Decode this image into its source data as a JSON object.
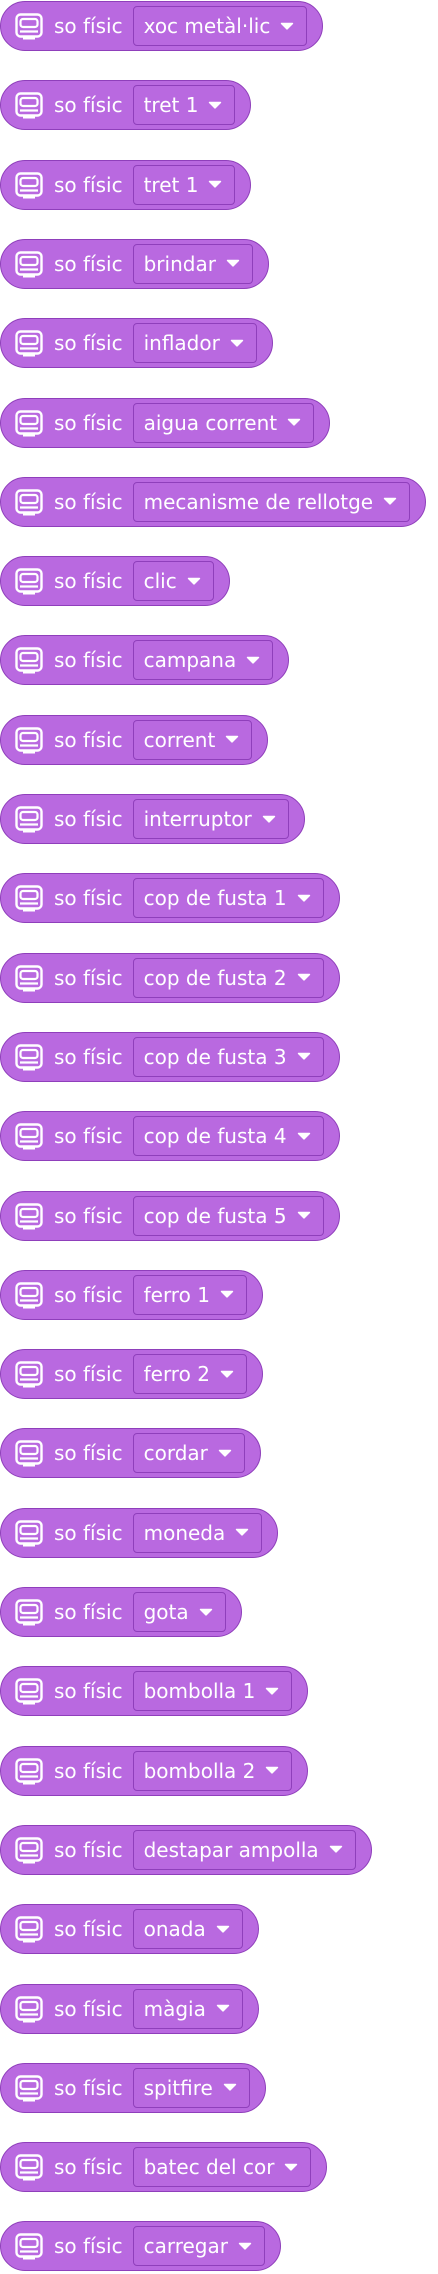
{
  "block_label": "so físic",
  "icon": "robot-speaker-icon",
  "colors": {
    "block_fill": "#b969e0",
    "block_border": "#8f3fbb",
    "text": "#ffffff"
  },
  "blocks": [
    {
      "value": "xoc metàl·lic"
    },
    {
      "value": "tret 1"
    },
    {
      "value": "tret 1"
    },
    {
      "value": "brindar"
    },
    {
      "value": "inflador"
    },
    {
      "value": "aigua corrent"
    },
    {
      "value": "mecanisme de rellotge"
    },
    {
      "value": "clic"
    },
    {
      "value": "campana"
    },
    {
      "value": "corrent"
    },
    {
      "value": "interruptor"
    },
    {
      "value": "cop de fusta 1"
    },
    {
      "value": "cop de fusta 2"
    },
    {
      "value": "cop de fusta 3"
    },
    {
      "value": "cop de fusta 4"
    },
    {
      "value": "cop de fusta 5"
    },
    {
      "value": "ferro 1"
    },
    {
      "value": "ferro 2"
    },
    {
      "value": "cordar"
    },
    {
      "value": "moneda"
    },
    {
      "value": "gota"
    },
    {
      "value": "bombolla 1"
    },
    {
      "value": "bombolla 2"
    },
    {
      "value": "destapar ampolla"
    },
    {
      "value": "onada"
    },
    {
      "value": "màgia"
    },
    {
      "value": "spitfire"
    },
    {
      "value": "batec del cor"
    },
    {
      "value": "carregar"
    }
  ]
}
